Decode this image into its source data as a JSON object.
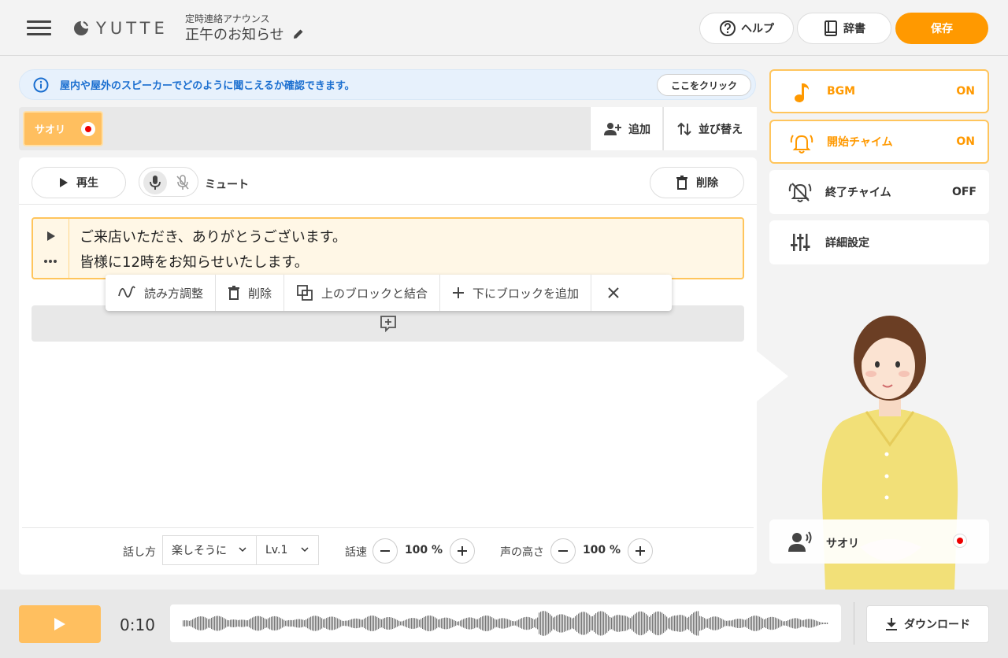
{
  "header": {
    "logo_text": "YUTTE",
    "subtitle": "定時連絡アナウンス",
    "title": "正午のお知らせ",
    "help_label": "ヘルプ",
    "dict_label": "辞書",
    "save_label": "保存"
  },
  "info": {
    "text": "屋内や屋外のスピーカーでどのように聞こえるか確認できます。",
    "button_label": "ここをクリック"
  },
  "speakers": {
    "active_name": "サオリ",
    "add_label": "追加",
    "sort_label": "並び替え"
  },
  "editor": {
    "play_label": "再生",
    "mute_label": "ミュート",
    "delete_label": "削除",
    "block_lines": [
      "ご来店いただき、ありがとうございます。",
      "皆様に12時をお知らせいたします。"
    ],
    "context_menu": {
      "adjust_reading": "読み方調整",
      "delete": "削除",
      "merge_above": "上のブロックと結合",
      "add_below": "下にブロックを追加"
    },
    "footer": {
      "style_label": "話し方",
      "style_value": "楽しそうに",
      "level_value": "Lv.1",
      "speed_label": "話速",
      "speed_value": "100 %",
      "pitch_label": "声の高さ",
      "pitch_value": "100 %"
    }
  },
  "right_panel": {
    "items": [
      {
        "name": "BGM",
        "state": "ON",
        "icon": "music-note-icon",
        "active": true
      },
      {
        "name": "開始チャイム",
        "state": "ON",
        "icon": "bell-ringing-icon",
        "active": true
      },
      {
        "name": "終了チャイム",
        "state": "OFF",
        "icon": "bell-off-icon",
        "active": false
      },
      {
        "name": "詳細設定",
        "state": "",
        "icon": "sliders-icon",
        "active": false
      }
    ],
    "speaker_card_name": "サオリ"
  },
  "player": {
    "time": "0:10",
    "download_label": "ダウンロード"
  },
  "colors": {
    "accent": "#ff9900",
    "chip": "#ffbf5f",
    "info_text": "#1b6fd0",
    "flag_red": "#e00000"
  }
}
